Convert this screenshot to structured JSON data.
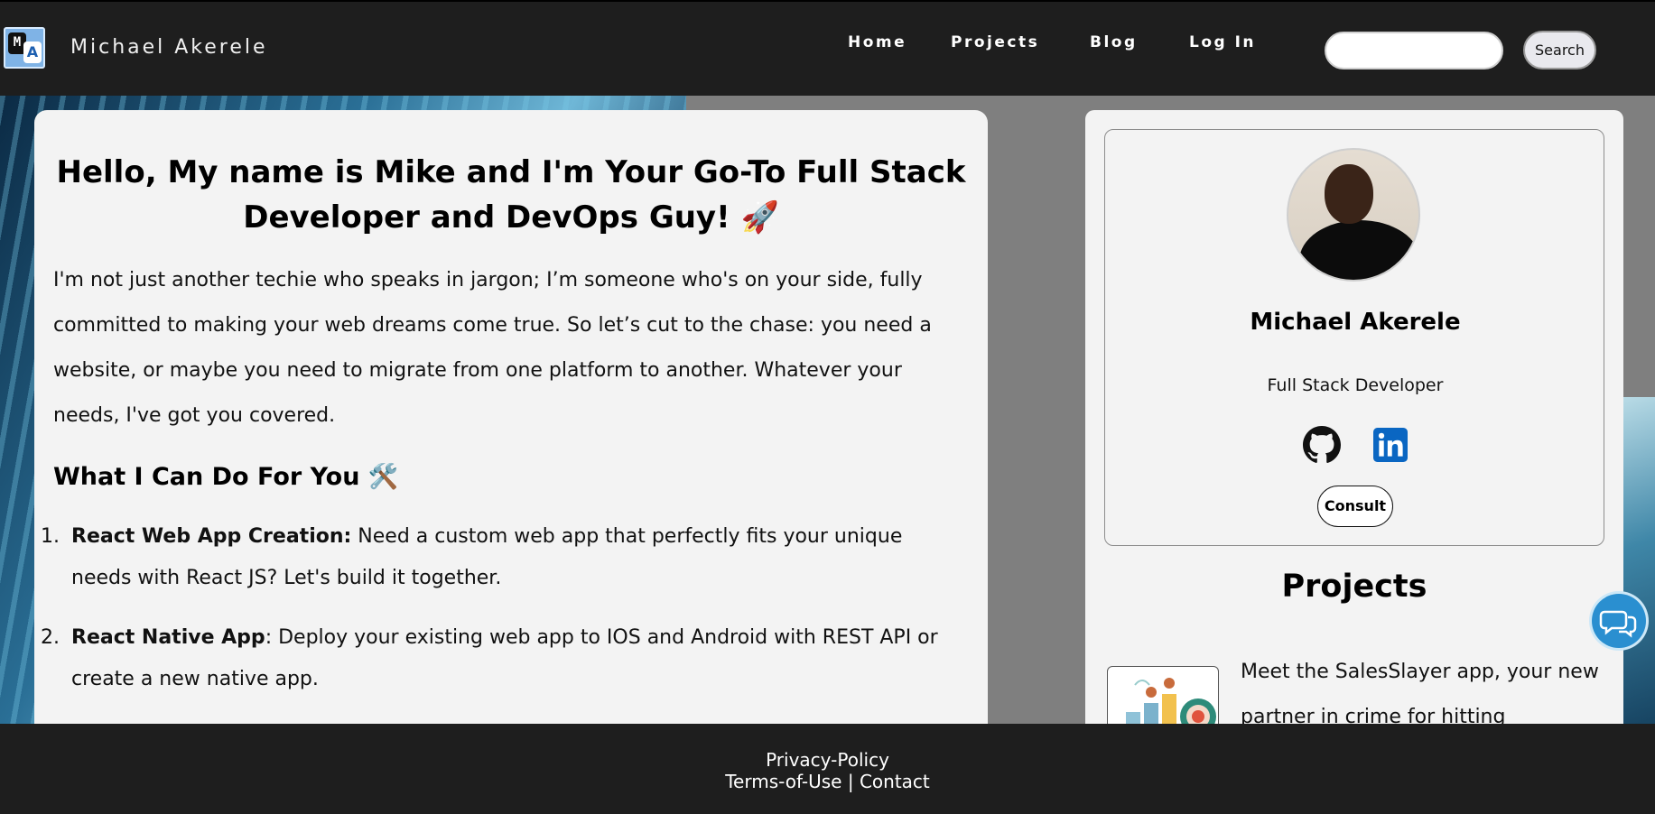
{
  "header": {
    "brand": "Michael Akerele",
    "logo_letters": "MA",
    "nav": [
      {
        "label": "Home"
      },
      {
        "label": "Projects"
      },
      {
        "label": "Blog"
      },
      {
        "label": "Log In"
      }
    ],
    "search": {
      "value": "",
      "button_label": "Search"
    }
  },
  "main": {
    "title": "Hello, My name is Mike and I'm Your Go-To Full Stack Developer and DevOps Guy! 🚀",
    "intro": "I'm not just another techie who speaks in jargon; I’m someone who's on your side, fully committed to making your web dreams come true. So let’s cut to the chase: you need a website, or maybe you need to migrate from one platform to another. Whatever your needs, I've got you covered.",
    "services_heading": "What I Can Do For You 🛠️",
    "services": [
      {
        "num": "1.",
        "title": "React Web App Creation:",
        "text": " Need a custom web app that perfectly fits your unique needs with React JS? Let's build it together."
      },
      {
        "num": "2.",
        "title": "React Native App",
        "text": ": Deploy your existing web app to IOS and Android with REST API or create a new native app."
      }
    ]
  },
  "sidebar": {
    "name": "Michael Akerele",
    "role": "Full Stack Developer",
    "consult_label": "Consult",
    "projects_heading": "Projects",
    "project_text": "Meet the SalesSlayer app, your new partner in crime for hitting"
  },
  "footer": {
    "privacy": "Privacy-Policy",
    "terms": "Terms-of-Use",
    "separator": " | ",
    "contact": "Contact"
  },
  "icons": {
    "github": "github-icon",
    "linkedin": "linkedin-icon",
    "chat": "chat-icon"
  },
  "colors": {
    "header_bg": "#1e1e1e",
    "card_bg": "#f3f3f3",
    "linkedin_blue": "#0a66c2",
    "chat_blue": "#2a8fd0"
  }
}
